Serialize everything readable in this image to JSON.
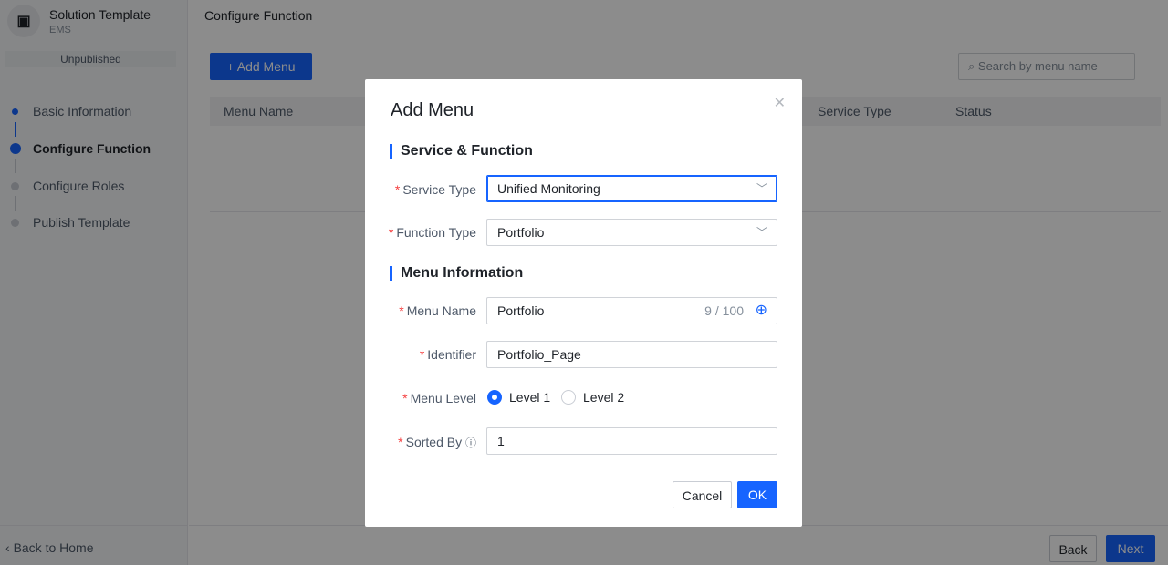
{
  "app": {
    "title": "Solution Template",
    "subtitle": "EMS",
    "status": "Unpublished"
  },
  "steps": [
    {
      "label": "Basic Information",
      "state": "done"
    },
    {
      "label": "Configure Function",
      "state": "active"
    },
    {
      "label": "Configure Roles",
      "state": "pending"
    },
    {
      "label": "Publish Template",
      "state": "pending"
    }
  ],
  "sidebar": {
    "back_label": "Back to Home"
  },
  "header": {
    "title": "Configure Function"
  },
  "toolbar": {
    "add_label": "Add Menu",
    "search_placeholder": "Search by menu name"
  },
  "table": {
    "columns": [
      "Menu Name",
      "Service Type",
      "Status"
    ]
  },
  "footer": {
    "back": "Back",
    "next": "Next"
  },
  "modal": {
    "title": "Add Menu",
    "section1": "Service & Function",
    "service_type_label": "Service Type",
    "service_type_value": "Unified Monitoring",
    "function_type_label": "Function Type",
    "function_type_value": "Portfolio",
    "section2": "Menu Information",
    "menu_name_label": "Menu Name",
    "menu_name_value": "Portfolio",
    "menu_name_count": "9 / 100",
    "identifier_label": "Identifier",
    "identifier_value": "Portfolio_Page",
    "menu_level_label": "Menu Level",
    "levels": [
      "Level 1",
      "Level 2"
    ],
    "selected_level": "Level 1",
    "sorted_by_label": "Sorted By",
    "sorted_by_value": "1",
    "cancel": "Cancel",
    "ok": "OK"
  },
  "colors": {
    "accent": "#1664ff",
    "required": "#f53f3f"
  }
}
